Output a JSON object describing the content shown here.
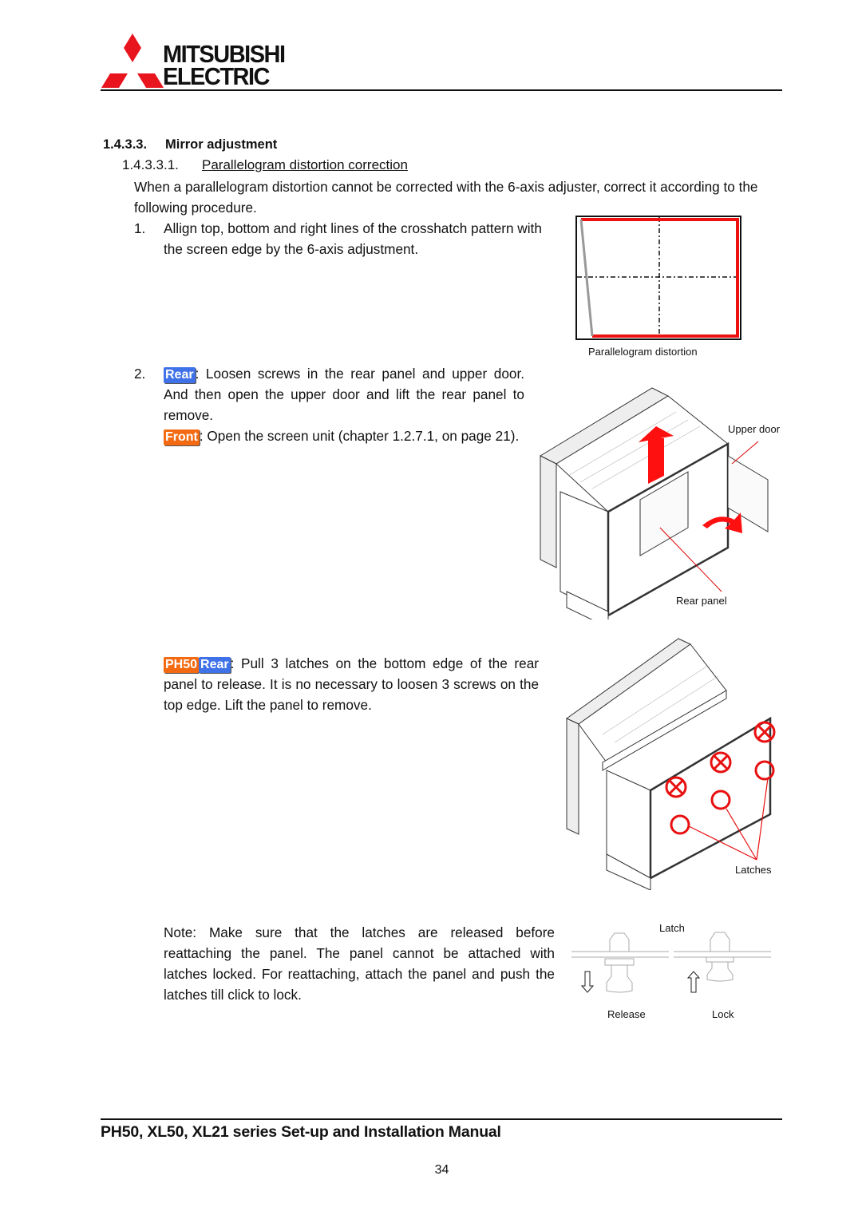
{
  "header": {
    "brand_line1": "MITSUBISHI",
    "brand_line2": "ELECTRIC",
    "brand_color": "#e8141e"
  },
  "section": {
    "number": "1.4.3.3.",
    "title": "Mirror adjustment",
    "subsection": {
      "number": "1.4.3.3.1.",
      "title": "Parallelogram distortion correction"
    },
    "intro": "When a parallelogram distortion cannot be corrected with the 6-axis adjuster, correct it according to the following procedure."
  },
  "steps": [
    {
      "number": "1.",
      "text": "Allign top, bottom and right lines of the crosshatch pattern with the screen edge by the 6-axis adjustment."
    },
    {
      "number": "2.",
      "rear_tag": "Rear",
      "rear_text": ": Loosen screws in the rear panel and upper door. And then open the upper door and lift the rear panel to remove.",
      "front_tag": "Front",
      "front_text": ": Open the screen unit (chapter 1.2.7.1, on page 21)."
    },
    {
      "ph50_tag": "PH50",
      "rear_tag": "Rear",
      "text": ": Pull 3 latches on the bottom edge of the rear panel to release. It is no necessary to loosen 3 screws on the top edge. Lift the panel to remove."
    }
  ],
  "note": "Note: Make sure that the latches are released before reattaching the panel. The panel cannot be attached with latches locked. For reattaching, attach the panel and push the latches till click to lock.",
  "figures": {
    "parallelogram": {
      "caption": "Parallelogram distortion"
    },
    "rear_panel": {
      "upper_door_label": "Upper door",
      "rear_panel_label": "Rear panel"
    },
    "latches": {
      "label": "Latches"
    },
    "latch_detail": {
      "title": "Latch",
      "release_label": "Release",
      "lock_label": "Lock"
    }
  },
  "tag_colors": {
    "rear": "#3f71e8",
    "front": "#f36a12",
    "ph50": "#f36a12"
  },
  "footer": {
    "title": "PH50, XL50, XL21 series Set-up and Installation Manual",
    "page_number": "34"
  }
}
